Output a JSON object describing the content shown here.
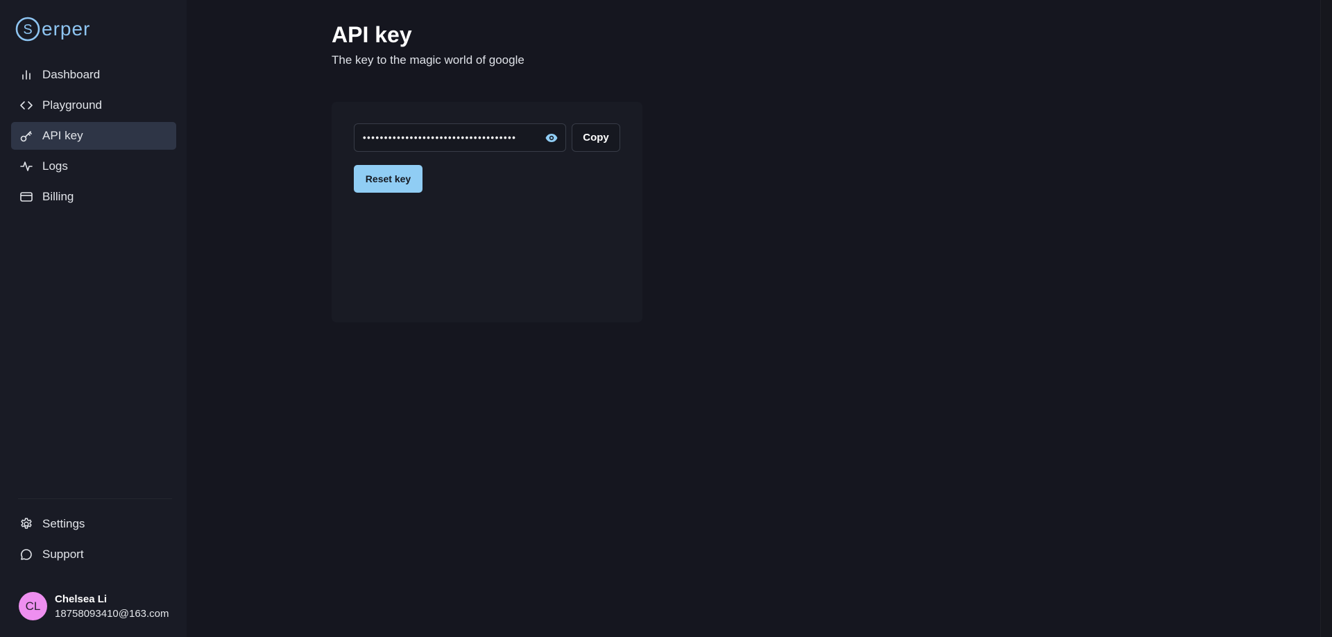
{
  "brand": {
    "name": "erper",
    "accent": "#8ec5f2"
  },
  "sidebar": {
    "items": [
      {
        "label": "Dashboard",
        "icon": "bar-chart-icon"
      },
      {
        "label": "Playground",
        "icon": "code-icon"
      },
      {
        "label": "API key",
        "icon": "key-icon",
        "active": true
      },
      {
        "label": "Logs",
        "icon": "activity-icon"
      },
      {
        "label": "Billing",
        "icon": "credit-card-icon"
      }
    ],
    "bottom": [
      {
        "label": "Settings",
        "icon": "gear-icon"
      },
      {
        "label": "Support",
        "icon": "chat-bubble-icon"
      }
    ]
  },
  "user": {
    "initials": "CL",
    "name": "Chelsea Li",
    "email": "18758093410@163.com",
    "avatar_color": "#ee8ff0"
  },
  "main": {
    "title": "API key",
    "subtitle": "The key to the magic world of google",
    "key_masked": "••••••••••••••••••••••••••••••••••••",
    "copy_label": "Copy",
    "reset_label": "Reset key",
    "button_color": "#90cdf4"
  }
}
